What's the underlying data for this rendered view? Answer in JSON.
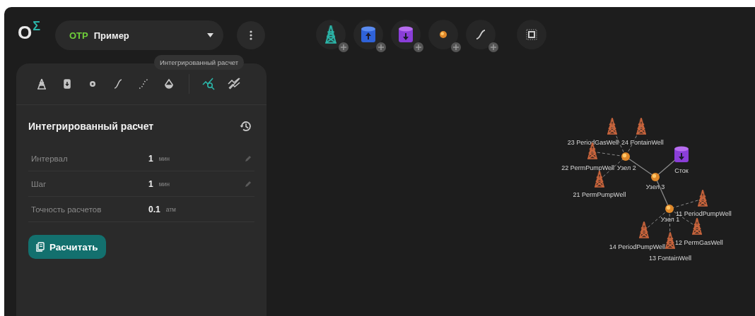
{
  "logo": {
    "letter": "O",
    "superscript": "Σ"
  },
  "project": {
    "code": "OTP",
    "name": "Пример"
  },
  "tooltip": "Интегрированный расчет",
  "panel_tools": [
    {
      "kind": "well",
      "selected": false
    },
    {
      "kind": "tank",
      "selected": false
    },
    {
      "kind": "node",
      "selected": false
    },
    {
      "kind": "pipe",
      "selected": false
    },
    {
      "kind": "path",
      "selected": false
    },
    {
      "kind": "drop",
      "selected": false
    },
    {
      "kind": "calc",
      "selected": true
    },
    {
      "kind": "compare",
      "selected": false
    }
  ],
  "panel": {
    "title": "Интегрированный расчет",
    "rows": [
      {
        "label": "Интервал",
        "value": "1",
        "unit": "мин",
        "editable": true
      },
      {
        "label": "Шаг",
        "value": "1",
        "unit": "мин",
        "editable": true
      },
      {
        "label": "Точность расчетов",
        "value": "0.1",
        "unit": "атм",
        "editable": false
      }
    ],
    "button": "Расчитать"
  },
  "canvas_tools": [
    {
      "kind": "well",
      "add_badge": true
    },
    {
      "kind": "source",
      "add_badge": true
    },
    {
      "kind": "sink",
      "add_badge": true
    },
    {
      "kind": "node",
      "add_badge": true
    },
    {
      "kind": "pipe",
      "add_badge": true
    },
    {
      "kind": "select",
      "add_badge": false
    }
  ],
  "diagram": {
    "nodes": [
      {
        "kind": "junction",
        "label": "Узел 2"
      },
      {
        "kind": "junction",
        "label": "Узел 3"
      },
      {
        "kind": "junction",
        "label": "Узел 1"
      },
      {
        "kind": "sink",
        "label": "Сток"
      },
      {
        "kind": "well",
        "label": "23 PeriodGasWell"
      },
      {
        "kind": "well",
        "label": "24 FontainWell"
      },
      {
        "kind": "well",
        "label": "22 PermPumpWell"
      },
      {
        "kind": "well",
        "label": "21 PermPumpWell"
      },
      {
        "kind": "well",
        "label": "11 PeriodPumpWell"
      },
      {
        "kind": "well",
        "label": "12 PermGasWell"
      },
      {
        "kind": "well",
        "label": "14 PeriodPumpWell"
      },
      {
        "kind": "well",
        "label": "13 FontainWell"
      }
    ]
  }
}
